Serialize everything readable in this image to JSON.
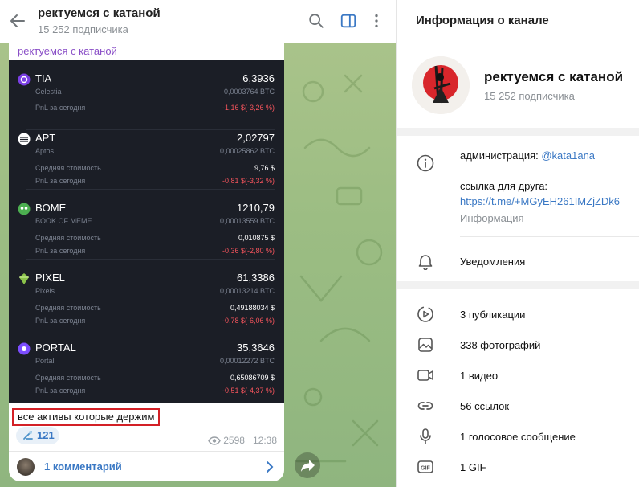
{
  "chat": {
    "title": "ректуемся с катаной",
    "subscribers": "15 252 подписчика"
  },
  "post": {
    "sender": "ректуемся с катаной",
    "assets": [
      {
        "symbol": "TIA",
        "name": "Celestia",
        "amount": "6,3936",
        "btc": "0,0003764 BTC",
        "pnl_label": "PnL за сегодня",
        "pnl": "-1,16 $(-3,26 %)",
        "icon_color": "#7b3fe4"
      },
      {
        "symbol": "APT",
        "name": "Aptos",
        "amount": "2,02797",
        "btc": "0,00025862 BTC",
        "avg_label": "Средняя стоимость",
        "avg": "9,76 $",
        "pnl_label": "PnL за сегодня",
        "pnl": "-0,81 $(-3,32 %)",
        "icon_color": "#ffffff"
      },
      {
        "symbol": "BOME",
        "name": "BOOK OF MEME",
        "amount": "1210,79",
        "btc": "0,00013559 BTC",
        "avg_label": "Средняя стоимость",
        "avg": "0,010875 $",
        "pnl_label": "PnL за сегодня",
        "pnl": "-0,36 $(-2,80 %)",
        "icon_color": "#4caf50"
      },
      {
        "symbol": "PIXEL",
        "name": "Pixels",
        "amount": "61,3386",
        "btc": "0,00013214 BTC",
        "avg_label": "Средняя стоимость",
        "avg": "0,49188034 $",
        "pnl_label": "PnL за сегодня",
        "pnl": "-0,78 $(-6,06 %)",
        "icon_color": "#8bc34a"
      },
      {
        "symbol": "PORTAL",
        "name": "Portal",
        "amount": "35,3646",
        "btc": "0,00012272 BTC",
        "avg_label": "Средняя стоимость",
        "avg": "0,65086709 $",
        "pnl_label": "PnL за сегодня",
        "pnl": "-0,51 $(-4,37 %)",
        "icon_color": "#7c4dff"
      }
    ],
    "caption": "все активы которые держим",
    "reaction_count": "121",
    "views": "2598",
    "time": "12:38",
    "comments_label": "1 комментарий"
  },
  "info": {
    "title": "Информация о канале",
    "channel_name": "ректуемся с катаной",
    "subscribers": "15 252 подписчика",
    "admin_prefix": "администрация: ",
    "admin_handle": "@kata1ana",
    "friend_label": "ссылка для друга:",
    "friend_link": "https://t.me/+MGyEH261IMZjZDk6",
    "info_label": "Информация",
    "notifications": "Уведомления",
    "media": [
      {
        "icon": "publications-icon",
        "label": "3 публикации"
      },
      {
        "icon": "photos-icon",
        "label": "338 фотографий"
      },
      {
        "icon": "video-icon",
        "label": "1 видео"
      },
      {
        "icon": "links-icon",
        "label": "56 ссылок"
      },
      {
        "icon": "voice-icon",
        "label": "1 голосовое сообщение"
      },
      {
        "icon": "gif-icon",
        "label": "1 GIF"
      }
    ]
  },
  "colors": {
    "accent": "#3a78c4",
    "negative": "#f5545c",
    "sender": "#8a4fc7",
    "highlight_border": "#d32026"
  }
}
